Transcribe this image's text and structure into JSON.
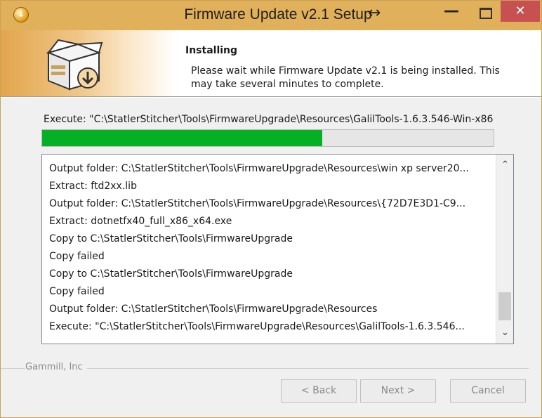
{
  "window": {
    "title": "Firmware Update v2.1 Setup",
    "resize_glyph": "↔",
    "minimize_glyph": "—",
    "close_glyph": "✕",
    "app_icon": "installer-icon",
    "app_icon_glyph": "↓"
  },
  "header": {
    "title": "Installing",
    "description": "Please wait while Firmware Update v2.1 is being installed. This may take several minutes to complete.",
    "image_icon": "package-download-icon"
  },
  "progress": {
    "execute_text": "Execute: \"C:\\StatlerStitcher\\Tools\\FirmwareUpgrade\\Resources\\GalilTools-1.6.3.546-Win-x86",
    "percent": 62
  },
  "log": {
    "lines": [
      "Output folder: C:\\StatlerStitcher\\Tools\\FirmwareUpgrade\\Resources\\win xp server20...",
      "Extract: ftd2xx.lib",
      "Output folder: C:\\StatlerStitcher\\Tools\\FirmwareUpgrade\\Resources\\{72D7E3D1-C9...",
      "Extract: dotnetfx40_full_x86_x64.exe",
      "Copy to C:\\StatlerStitcher\\Tools\\FirmwareUpgrade",
      "Copy failed",
      "Copy to C:\\StatlerStitcher\\Tools\\FirmwareUpgrade",
      "Copy failed",
      "Output folder: C:\\StatlerStitcher\\Tools\\FirmwareUpgrade\\Resources",
      "Execute: \"C:\\StatlerStitcher\\Tools\\FirmwareUpgrade\\Resources\\GalilTools-1.6.3.546..."
    ],
    "scroll_up_glyph": "⌃",
    "scroll_down_glyph": "⌄"
  },
  "footer": {
    "company": "Gammill, Inc",
    "back_label": "< Back",
    "next_label": "Next >",
    "cancel_label": "Cancel"
  },
  "colors": {
    "progress_fill": "#06b025",
    "title_bar": "#e1b05b",
    "close_button": "#c75050"
  }
}
